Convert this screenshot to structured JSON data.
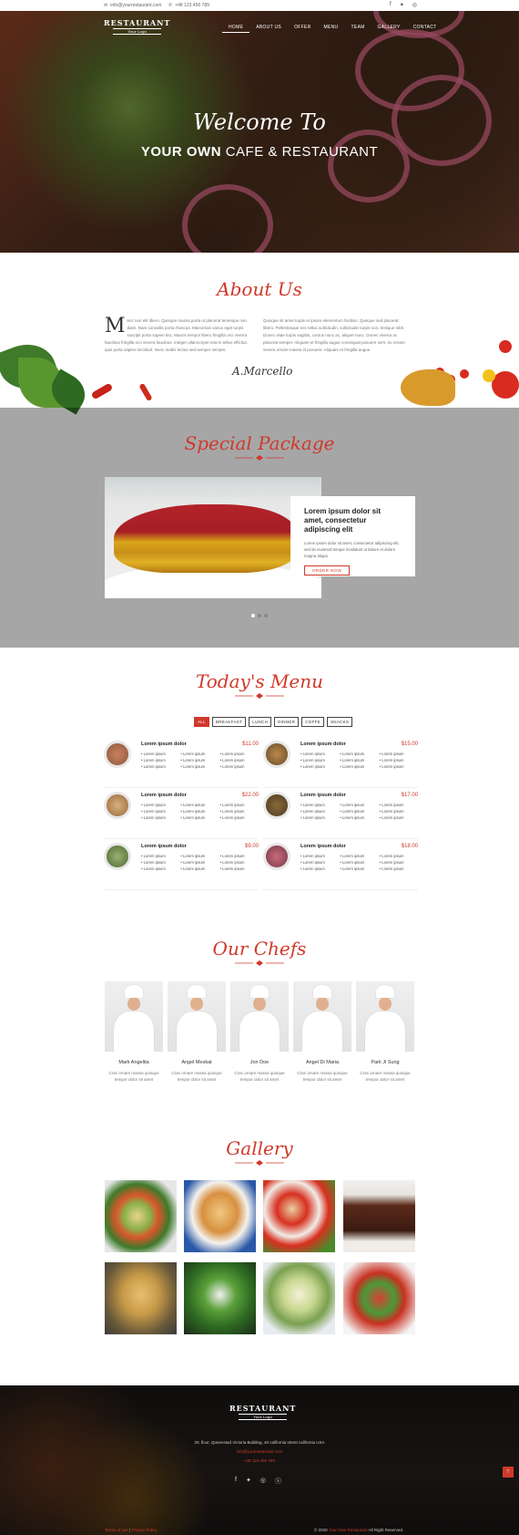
{
  "topbar": {
    "email": "info@yourrestaurant.com",
    "phone": "+48 123 456 789"
  },
  "brand": {
    "name": "RESTAURANT",
    "tagline": "Your Logo"
  },
  "nav": {
    "items": [
      "HOME",
      "ABOUT US",
      "OFFER",
      "MENU",
      "TEAM",
      "GALLERY",
      "CONTACT"
    ]
  },
  "hero": {
    "line1": "Welcome To",
    "line2_bold": "YOUR OWN",
    "line2_rest": "CAFE & RESTAURANT"
  },
  "about": {
    "title": "About Us",
    "dropcap": "M",
    "col1": "enc non elit libero. Quisque massa porta ut placerat tenesque non diam. Nam convallis porta rhoncus. Maecenas varius eget turpis suscipit porta sapien tinc. Mauris tempor libero fringilla orci viverra faucibus fringilla orci viverra faucibus. Integer ullamcorper erat in tellus efficitur, quis porta sapien tincidunt. Nunc mattis lectus sed semper semper.",
    "col2": "Quisque sit amet turpis et ipsum elementum facilisis. Quisque sed placerat libero. Pellentesque nec tellus sollicitudin, sollicitudin turpis non, tristique nibh. Donec vitae turpis sagittis, cursus nunc ac, aliquet nunc. Donec viverra ac placerat semper. Aliquam et fringilla augue consequat posuere sem, eu ornare viverra ornare massa id posuere. Aliquam et fringilla augue",
    "signature": "A.Marcello"
  },
  "special": {
    "title": "Special Package",
    "card_title": "Lorem ipsum dolor sit amet, consectetur adipiscing elit",
    "card_desc": "Lorem ipsum dolor sit amet, consectetur adipiscing elit, sed do eiusmod tempor incididunt ut labore et dolore magna aliqua.",
    "card_button": "ORDER NOW"
  },
  "menu": {
    "title": "Today's Menu",
    "tabs": [
      "ALL",
      "BREAKFAST",
      "LUNCH",
      "DINNER",
      "COFFE",
      "SNACKS"
    ],
    "items": [
      {
        "name": "Lorem ipsum dolor",
        "price": "$11.00",
        "ing": [
          "Lorem ipsum",
          "Lorem ipsum",
          "Lorem ipsum",
          "Lorem ipsum",
          "Lorem ipsum",
          "Lorem ipsum",
          "Lorem ipsum",
          "Lorem ipsum",
          "Lorem ipsum"
        ]
      },
      {
        "name": "Lorem ipsum dolor",
        "price": "$15.00",
        "ing": [
          "Lorem ipsum",
          "Lorem ipsum",
          "Lorem ipsum",
          "Lorem ipsum",
          "Lorem ipsum",
          "Lorem ipsum",
          "Lorem ipsum",
          "Lorem ipsum",
          "Lorem ipsum"
        ]
      },
      {
        "name": "Lorem ipsum dolor",
        "price": "$22.00",
        "ing": [
          "Lorem ipsum",
          "Lorem ipsum",
          "Lorem ipsum",
          "Lorem ipsum",
          "Lorem ipsum",
          "Lorem ipsum",
          "Lorem ipsum",
          "Lorem ipsum",
          "Lorem ipsum"
        ]
      },
      {
        "name": "Lorem ipsum dolor",
        "price": "$17.00",
        "ing": [
          "Lorem ipsum",
          "Lorem ipsum",
          "Lorem ipsum",
          "Lorem ipsum",
          "Lorem ipsum",
          "Lorem ipsum",
          "Lorem ipsum",
          "Lorem ipsum",
          "Lorem ipsum"
        ]
      },
      {
        "name": "Lorem ipsum dolor",
        "price": "$9.00",
        "ing": [
          "Lorem ipsum",
          "Lorem ipsum",
          "Lorem ipsum",
          "Lorem ipsum",
          "Lorem ipsum",
          "Lorem ipsum",
          "Lorem ipsum",
          "Lorem ipsum",
          "Lorem ipsum"
        ]
      },
      {
        "name": "Lorem ipsum dolor",
        "price": "$18.00",
        "ing": [
          "Lorem ipsum",
          "Lorem ipsum",
          "Lorem ipsum",
          "Lorem ipsum",
          "Lorem ipsum",
          "Lorem ipsum",
          "Lorem ipsum",
          "Lorem ipsum",
          "Lorem ipsum"
        ]
      }
    ]
  },
  "chefs": {
    "title": "Our Chefs",
    "list": [
      {
        "name": "Mark Angelita",
        "desc": "Cras ornare massa quisque tempor dolor sit amet"
      },
      {
        "name": "Angel Meskat",
        "desc": "Cras ornare massa quisque tempor dolor sit amet"
      },
      {
        "name": "Jon Doe",
        "desc": "Cras ornare massa quisque tempor dolor sit amet"
      },
      {
        "name": "Angel Di Maria",
        "desc": "Cras ornare massa quisque tempor dolor sit amet"
      },
      {
        "name": "Park Ji Sung",
        "desc": "Cras ornare massa quisque tempor dolor sit amet"
      }
    ]
  },
  "gallery": {
    "title": "Gallery"
  },
  "footer": {
    "address": "20, floor, Queenstad Victoria Building, 40 california street california USA",
    "email": "info@yourrestaurant.com",
    "phone": "+48 123 456 789",
    "left_terms": "Terms of use",
    "left_privacy": "Privacy Policy",
    "copy_prefix": "© 2020",
    "copy_brand": "Your Own Restaurant",
    "copy_suffix": "All Right Reserved."
  },
  "colors": {
    "accent": "#d0392b",
    "dark": "#222222"
  },
  "icons": {
    "email": "envelope-icon",
    "phone": "phone-icon",
    "facebook": "facebook-icon",
    "twitter": "twitter-icon",
    "instagram": "instagram-icon",
    "skype": "skype-icon",
    "totop": "arrow-up-icon"
  }
}
